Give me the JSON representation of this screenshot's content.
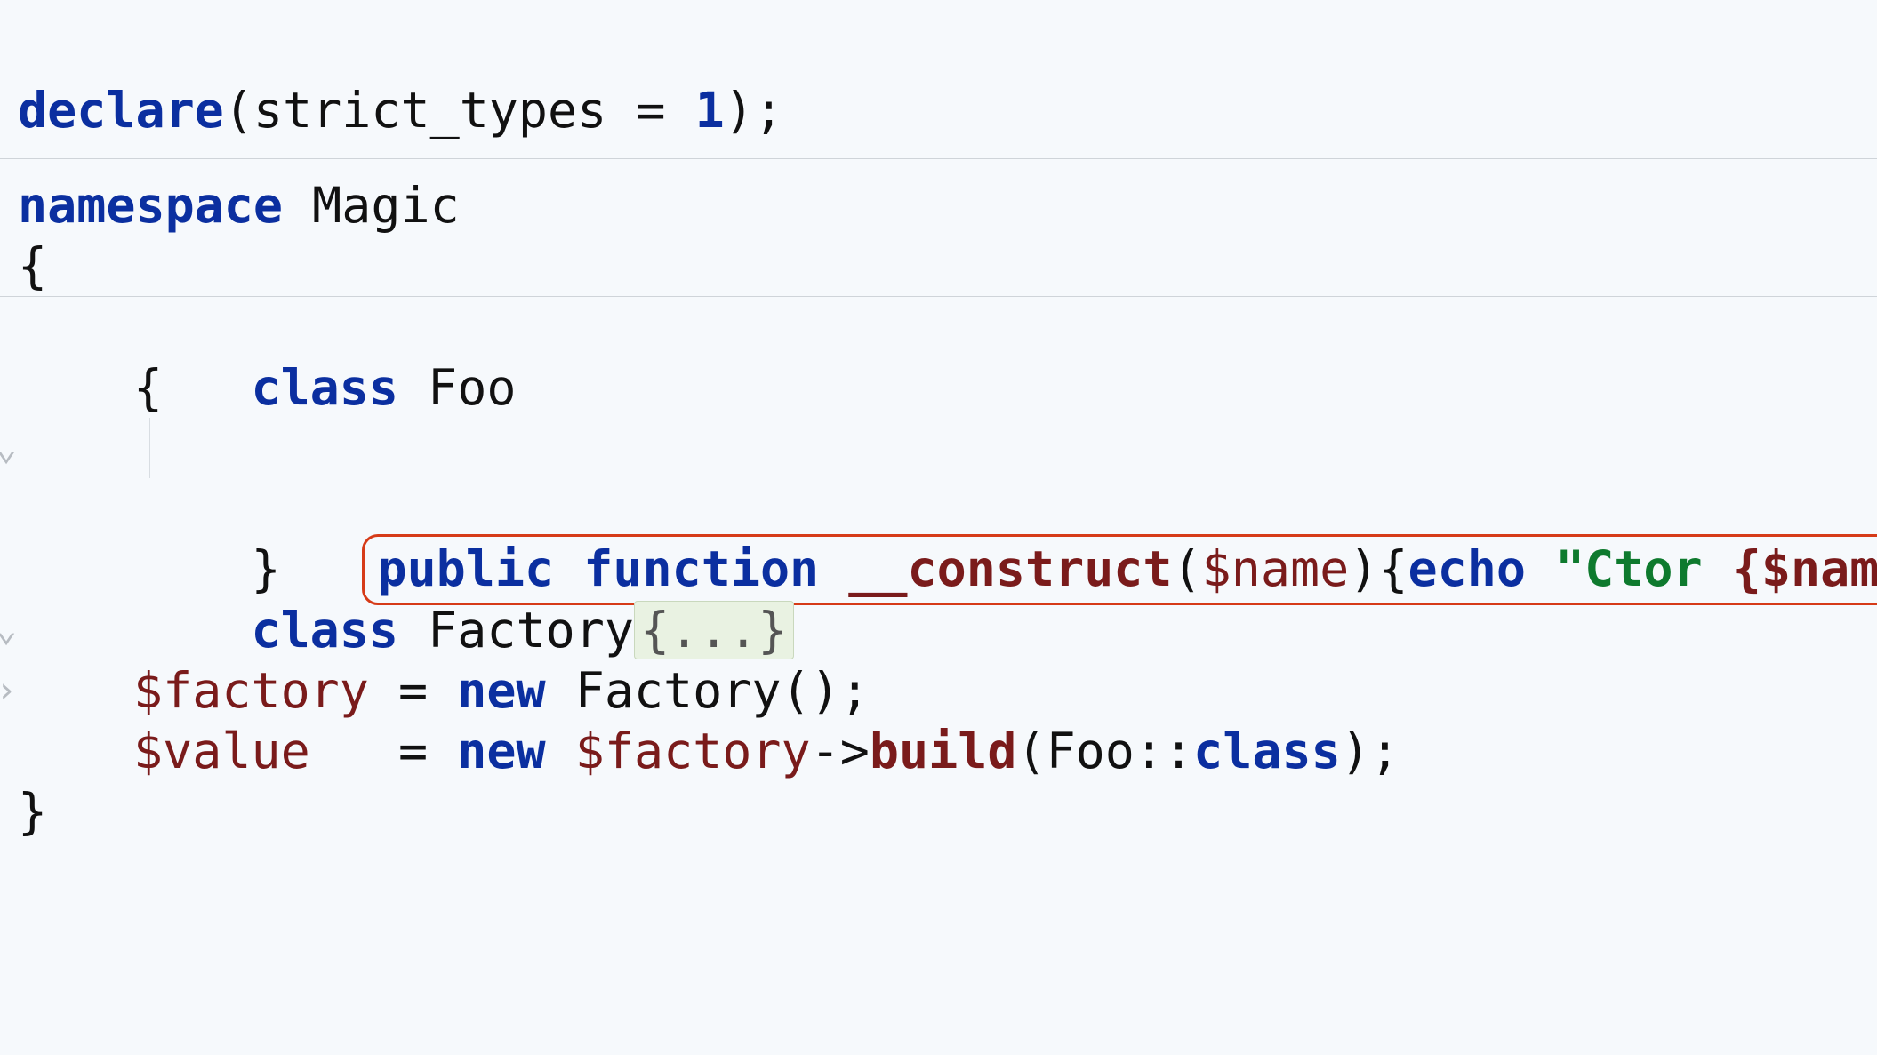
{
  "code": {
    "l1_declare": "declare",
    "l1_args": "(strict_types = ",
    "l1_one": "1",
    "l1_end": ");",
    "l3_ns": "namespace",
    "l3_name": " Magic",
    "l4_brace": "{",
    "l5_class": "class",
    "l5_name": " Foo",
    "l6_brace": "{",
    "hl_public": "public",
    "hl_sp1": " ",
    "hl_function": "function",
    "hl_sp2": " ",
    "hl_fname": "__construct",
    "hl_open": "(",
    "hl_arg": "$name",
    "hl_close": "){",
    "hl_echo": "echo",
    "hl_sp3": " ",
    "hl_str1": "\"Ctor ",
    "hl_strvar": "{$name}",
    "hl_str2": "\"",
    "hl_semi": ";}",
    "l8_brace": "}",
    "l9_class": "class",
    "l9_name": " Factory",
    "l9_fold": "{...}",
    "l11_var": "$factory",
    "l11_eq": " = ",
    "l11_new": "new",
    "l11_call": " Factory();",
    "l12_var": "$value",
    "l12_eq": "   = ",
    "l12_new": "new",
    "l12_sp": " ",
    "l12_obj": "$factory",
    "l12_arrow": "->",
    "l12_method": "build",
    "l12_open": "(Foo::",
    "l12_classkw": "class",
    "l12_close": ");",
    "l13_brace": "}"
  }
}
